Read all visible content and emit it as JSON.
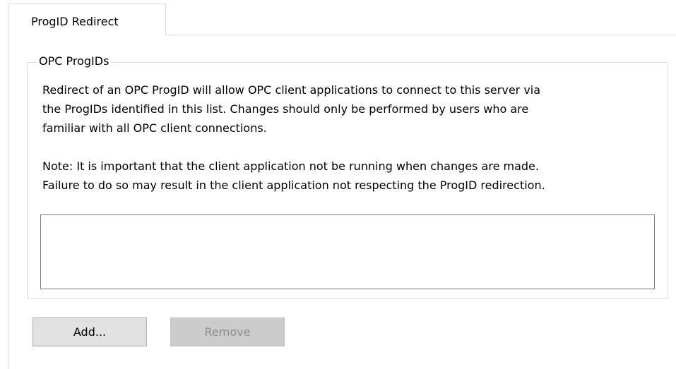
{
  "tabs": [
    {
      "label": "ProgID Redirect",
      "selected": true
    }
  ],
  "group": {
    "legend": "OPC ProgIDs",
    "description": "Redirect of an OPC ProgID will allow OPC client applications to connect to this server via\nthe ProgIDs identified in this list. Changes should only be performed by users who are\nfamiliar with all OPC client connections.",
    "note": "Note: It is important that the client application not be running when changes are made.\nFailure to do so may result in the client application not respecting the ProgID redirection.",
    "progid_list": {
      "items": []
    }
  },
  "buttons": {
    "add_label": "Add...",
    "remove_label": "Remove",
    "remove_enabled": false
  },
  "colors": {
    "border": "#d9d9d9",
    "button_face": "#e1e1e1",
    "disabled_text": "#8c8c8c"
  }
}
